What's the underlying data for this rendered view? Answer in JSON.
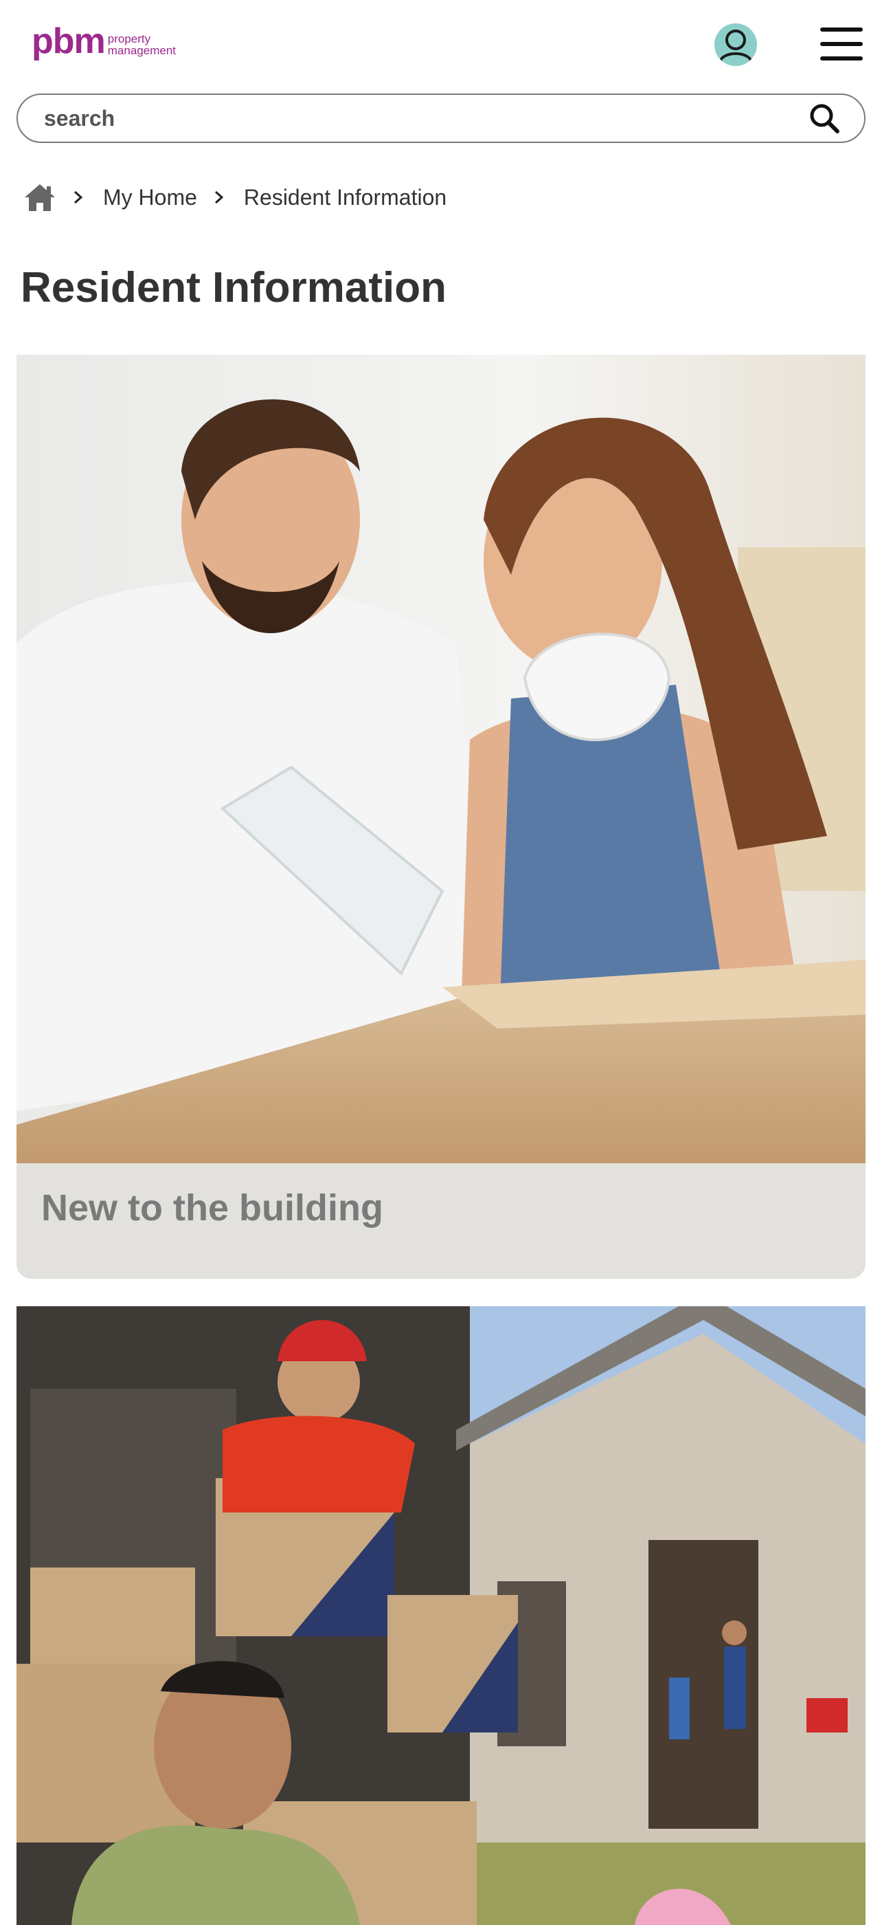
{
  "header": {
    "logo_mark": "pbm",
    "logo_line1": "property",
    "logo_line2": "management",
    "account_icon": "user-icon",
    "menu_icon": "hamburger-menu-icon"
  },
  "search": {
    "placeholder": "search",
    "value": "",
    "icon": "search-icon"
  },
  "breadcrumb": {
    "home_icon": "home-icon",
    "separator_icon": "chevron-right-icon",
    "items": [
      {
        "label": "My Home"
      },
      {
        "label": "Resident Information"
      }
    ]
  },
  "page": {
    "title": "Resident Information"
  },
  "cards": [
    {
      "label": "New to the building",
      "image": "couple-unpacking-photo"
    },
    {
      "label": "",
      "image": "movers-with-boxes-photo"
    }
  ],
  "colors": {
    "brand": "#9c2a8c",
    "card_background": "#e3e1dd",
    "card_text": "#7a7a7a",
    "avatar": "#8ccfca"
  }
}
